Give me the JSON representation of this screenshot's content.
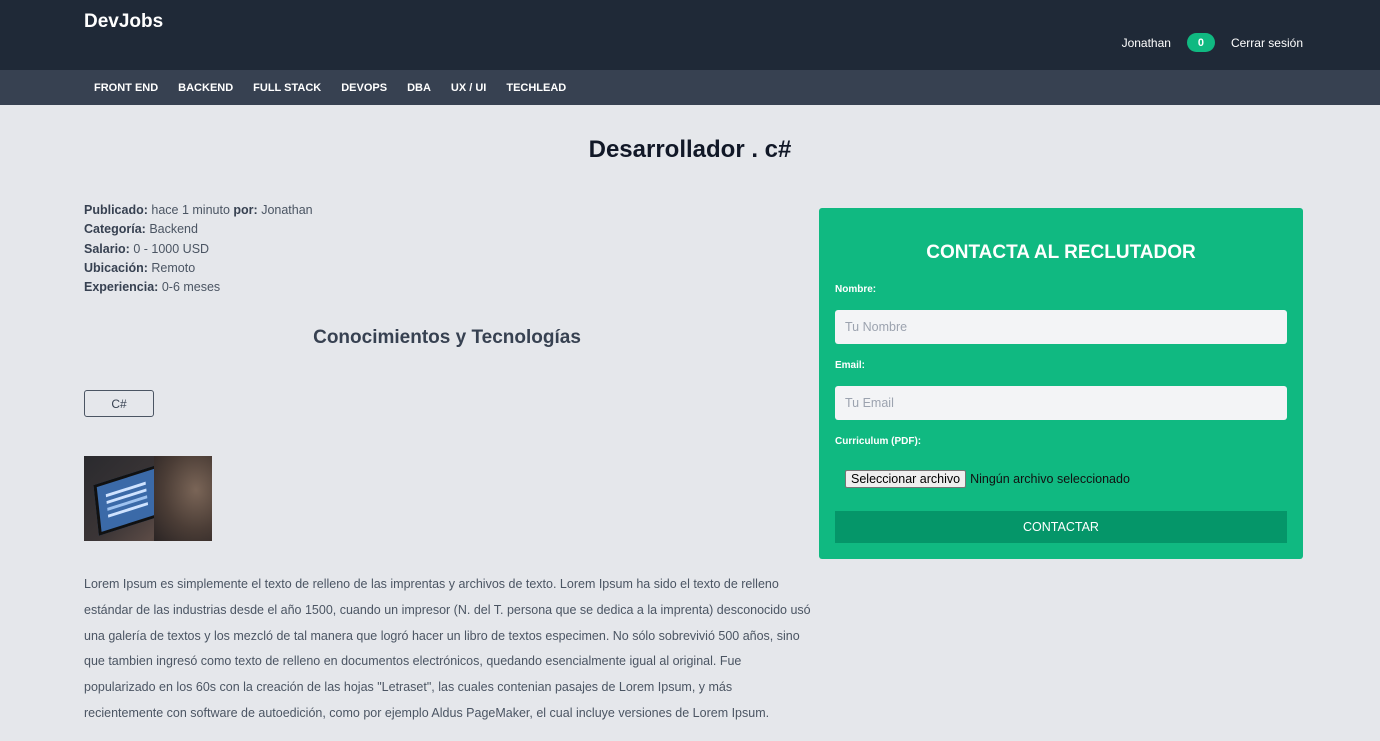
{
  "header": {
    "brand": "DevJobs",
    "user_name": "Jonathan",
    "notification_count": "0",
    "logout_label": "Cerrar sesión"
  },
  "nav": {
    "items": [
      "FRONT END",
      "BACKEND",
      "FULL STACK",
      "DEVOPS",
      "DBA",
      "UX / UI",
      "TECHLEAD"
    ]
  },
  "job": {
    "title": "Desarrollador . c#",
    "published_label": "Publicado:",
    "published_value": "hace 1 minuto",
    "by_label": "por:",
    "by_value": "Jonathan",
    "category_label": "Categoría:",
    "category_value": "Backend",
    "salary_label": "Salario:",
    "salary_value": "0 - 1000 USD",
    "location_label": "Ubicación:",
    "location_value": "Remoto",
    "experience_label": "Experiencia:",
    "experience_value": "0-6 meses",
    "tech_heading": "Conocimientos y Tecnologías",
    "tech_tags": [
      "C#"
    ],
    "description": "Lorem Ipsum es simplemente el texto de relleno de las imprentas y archivos de texto. Lorem Ipsum ha sido el texto de relleno estándar de las industrias desde el año 1500, cuando un impresor (N. del T. persona que se dedica a la imprenta) desconocido usó una galería de textos y los mezcló de tal manera que logró hacer un libro de textos especimen. No sólo sobrevivió 500 años, sino que tambien ingresó como texto de relleno en documentos electrónicos, quedando esencialmente igual al original. Fue popularizado en los 60s con la creación de las hojas \"Letraset\", las cuales contenian pasajes de Lorem Ipsum, y más recientemente con software de autoedición, como por ejemplo Aldus PageMaker, el cual incluye versiones de Lorem Ipsum."
  },
  "contact": {
    "title": "CONTACTA AL RECLUTADOR",
    "name_label": "Nombre:",
    "name_placeholder": "Tu Nombre",
    "email_label": "Email:",
    "email_placeholder": "Tu Email",
    "cv_label": "Curriculum (PDF):",
    "file_button": "Seleccionar archivo",
    "file_status": "Ningún archivo seleccionado",
    "submit_label": "CONTACTAR"
  },
  "colors": {
    "header_bg": "#1f2937",
    "nav_bg": "#374151",
    "page_bg": "#e5e7eb",
    "accent": "#10b981",
    "accent_dark": "#059669"
  }
}
